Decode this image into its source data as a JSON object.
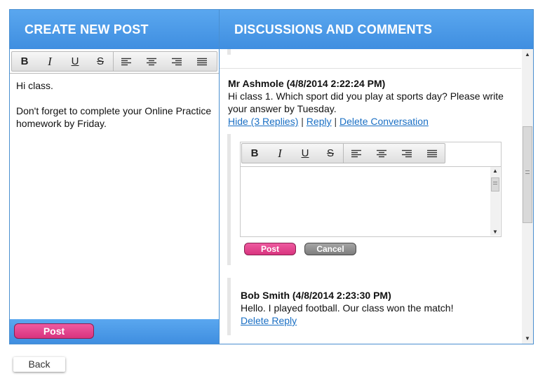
{
  "create_panel": {
    "title": "CREATE NEW POST",
    "editor_lines": [
      "Hi class.",
      "Don't forget to complete your Online Practice homework by Friday."
    ],
    "post_label": "Post"
  },
  "discussion_panel": {
    "title": "DISCUSSIONS AND COMMENTS",
    "message": {
      "author": "Mr Ashmole (4/8/2014 2:22:24 PM)",
      "text": "Hi class 1. Which sport did you play at sports day? Please write your answer by Tuesday.",
      "hide_label": "Hide (3 Replies)",
      "reply_label": "Reply",
      "delete_label": "Delete Conversation",
      "separator": "|"
    },
    "reply_editor": {
      "post_label": "Post",
      "cancel_label": "Cancel"
    },
    "reply": {
      "author": "Bob Smith (4/8/2014 2:23:30 PM)",
      "text": "Hello. I played football. Our class won the match!",
      "delete_label": "Delete Reply"
    }
  },
  "toolbar": {
    "bold": "B",
    "italic": "I",
    "underline": "U",
    "strike": "S"
  },
  "footer": {
    "back_label": "Back"
  },
  "colors": {
    "header_blue": "#4a9be8",
    "post_pink": "#e0438b",
    "link_blue": "#1a6fc4"
  }
}
